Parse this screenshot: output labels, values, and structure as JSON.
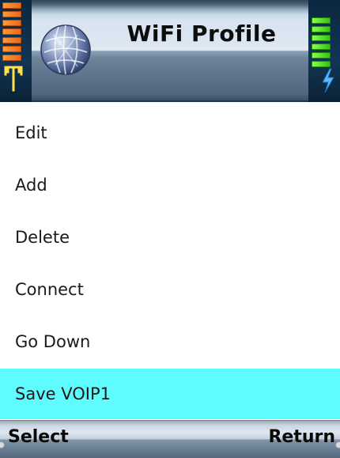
{
  "header": {
    "title": "WiFi Profile",
    "left_icon": "globe-icon",
    "signal_icon": "antenna-icon",
    "battery_icon": "bolt-icon",
    "signal_level": 0.6,
    "battery_level": 0.9
  },
  "menu": {
    "items": [
      {
        "label": "Edit"
      },
      {
        "label": "Add"
      },
      {
        "label": "Delete"
      },
      {
        "label": "Connect"
      },
      {
        "label": "Go Down"
      },
      {
        "label": "Save VOIP1"
      }
    ],
    "selected_index": 5
  },
  "softkeys": {
    "left_label": "Select",
    "right_label": "Return"
  },
  "colors": {
    "highlight": "#5ffcff",
    "signal": "#e8681a",
    "battery": "#34c20e"
  }
}
